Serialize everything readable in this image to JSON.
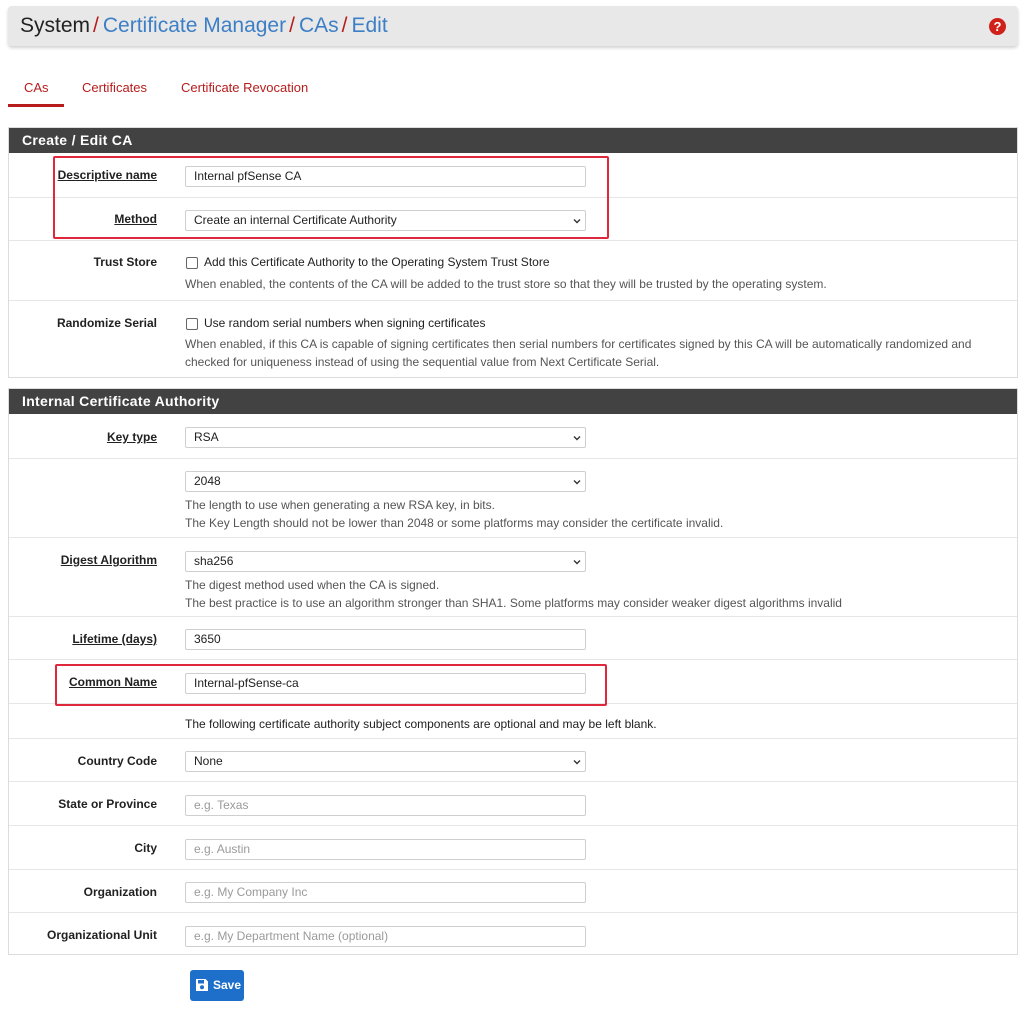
{
  "breadcrumb": {
    "items": [
      "System",
      "Certificate Manager",
      "CAs",
      "Edit"
    ],
    "separator": "/"
  },
  "help_icon": "?",
  "tabs": [
    {
      "label": "CAs",
      "active": true
    },
    {
      "label": "Certificates",
      "active": false
    },
    {
      "label": "Certificate Revocation",
      "active": false
    }
  ],
  "create_panel": {
    "title": "Create / Edit CA",
    "descriptive_name": {
      "label": "Descriptive name",
      "value": "Internal pfSense CA"
    },
    "method": {
      "label": "Method",
      "value": "Create an internal Certificate Authority"
    },
    "trust_store": {
      "label": "Trust Store",
      "checkbox_label": "Add this Certificate Authority to the Operating System Trust Store",
      "checked": false,
      "help": "When enabled, the contents of the CA will be added to the trust store so that they will be trusted by the operating system."
    },
    "randomize_serial": {
      "label": "Randomize Serial",
      "checkbox_label": "Use random serial numbers when signing certificates",
      "checked": false,
      "help_line1": "When enabled, if this CA is capable of signing certificates then serial numbers for certificates signed by this CA will be automatically randomized and",
      "help_line2": "checked for uniqueness instead of using the sequential value from Next Certificate Serial."
    }
  },
  "internal_panel": {
    "title": "Internal Certificate Authority",
    "key_type": {
      "label": "Key type",
      "value": "RSA"
    },
    "key_length": {
      "value": "2048",
      "help_line1": "The length to use when generating a new RSA key, in bits.",
      "help_line2": "The Key Length should not be lower than 2048 or some platforms may consider the certificate invalid."
    },
    "digest": {
      "label": "Digest Algorithm",
      "value": "sha256",
      "help_line1": "The digest method used when the CA is signed.",
      "help_line2": "The best practice is to use an algorithm stronger than SHA1. Some platforms may consider weaker digest algorithms invalid"
    },
    "lifetime": {
      "label": "Lifetime (days)",
      "value": "3650"
    },
    "common_name": {
      "label": "Common Name",
      "value": "Internal-pfSense-ca"
    },
    "optional_note": "The following certificate authority subject components are optional and may be left blank.",
    "country_code": {
      "label": "Country Code",
      "value": "None"
    },
    "state": {
      "label": "State or Province",
      "placeholder": "e.g. Texas"
    },
    "city": {
      "label": "City",
      "placeholder": "e.g. Austin"
    },
    "organization": {
      "label": "Organization",
      "placeholder": "e.g. My Company Inc"
    },
    "org_unit": {
      "label": "Organizational Unit",
      "placeholder": "e.g. My Department Name (optional)"
    }
  },
  "save_button": {
    "label": "Save"
  },
  "colors": {
    "accent_red": "#b71c1c",
    "header_dark": "#424242",
    "link_blue": "#3d7fc6",
    "save_blue": "#1e6fc9",
    "highlight": "#e0283c"
  }
}
